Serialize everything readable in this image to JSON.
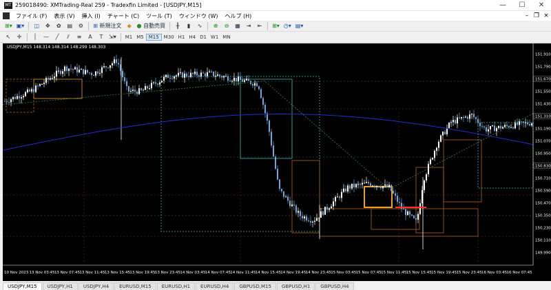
{
  "window": {
    "title": "259018490: XMTrading-Real 259 - Tradexfin Limited - [USDJPY,M15]",
    "app_icon_label": "MT",
    "minimize": "—",
    "maximize": "☐",
    "close": "✕"
  },
  "menu": {
    "items": [
      "ファイル (F)",
      "表示 (V)",
      "挿入 (I)",
      "チャート (C)",
      "ツール (T)",
      "ウィンドウ (W)",
      "ヘルプ (H)"
    ]
  },
  "toolbar": {
    "new_order": "新規注文",
    "auto_trade": "自動売買",
    "timeframes": [
      "M1",
      "M5",
      "M15",
      "M30",
      "H1",
      "H4",
      "D1",
      "W1",
      "MN"
    ],
    "active_timeframe": "M15",
    "text_tool": "A",
    "label_tool": "T"
  },
  "chart": {
    "info": "USDJPY,M15  148.314 148.314 148.299 148.303",
    "colors": {
      "background": "#000000",
      "bull": "#ffffff",
      "bear": "#6fa8dc",
      "ma_blue": "#1f2fd0",
      "ma_green": "#2e8b2e",
      "box_orange": "#f0a030",
      "box_brown": "#b5651d",
      "box_cyan": "#3bb8b0",
      "box_red": "#c04040",
      "line_red": "#ff3030",
      "axis_text": "#ffffff"
    },
    "y_labels": [
      "151.910",
      "151.790",
      "151.550",
      "151.430",
      "151.190",
      "151.070",
      "150.950",
      "150.710",
      "150.590",
      "150.470",
      "150.350",
      "150.230",
      "150.110",
      "149.990"
    ],
    "y_boxed": [
      {
        "label": "151.670",
        "y": 151.67
      },
      {
        "label": "151.310",
        "y": 151.31
      },
      {
        "label": "150.830",
        "y": 150.83
      }
    ],
    "x_labels": [
      "10 Nov 2023",
      "13 Nov 03:45",
      "13 Nov 07:45",
      "13 Nov 11:45",
      "13 Nov 15:45",
      "13 Nov 19:45",
      "13 Nov 23:45",
      "14 Nov 03:45",
      "14 Nov 07:45",
      "14 Nov 11:45",
      "14 Nov 15:45",
      "14 Nov 19:45",
      "14 Nov 23:45",
      "15 Nov 03:45",
      "15 Nov 07:45",
      "15 Nov 11:45",
      "15 Nov 15:45",
      "15 Nov 19:45",
      "15 Nov 23:45",
      "16 Nov 03:45",
      "16 Nov 07:45"
    ]
  },
  "tabs": {
    "items": [
      "USDJPY,M15",
      "USDJPY,H1",
      "USDJPY,H4",
      "EURUSD,M15",
      "EURUSD,H1",
      "EURUSD,H4",
      "GBPUSD,M15",
      "GBPUSD,H1",
      "GBPUSD,H4"
    ],
    "active": "USDJPY,M15"
  }
}
